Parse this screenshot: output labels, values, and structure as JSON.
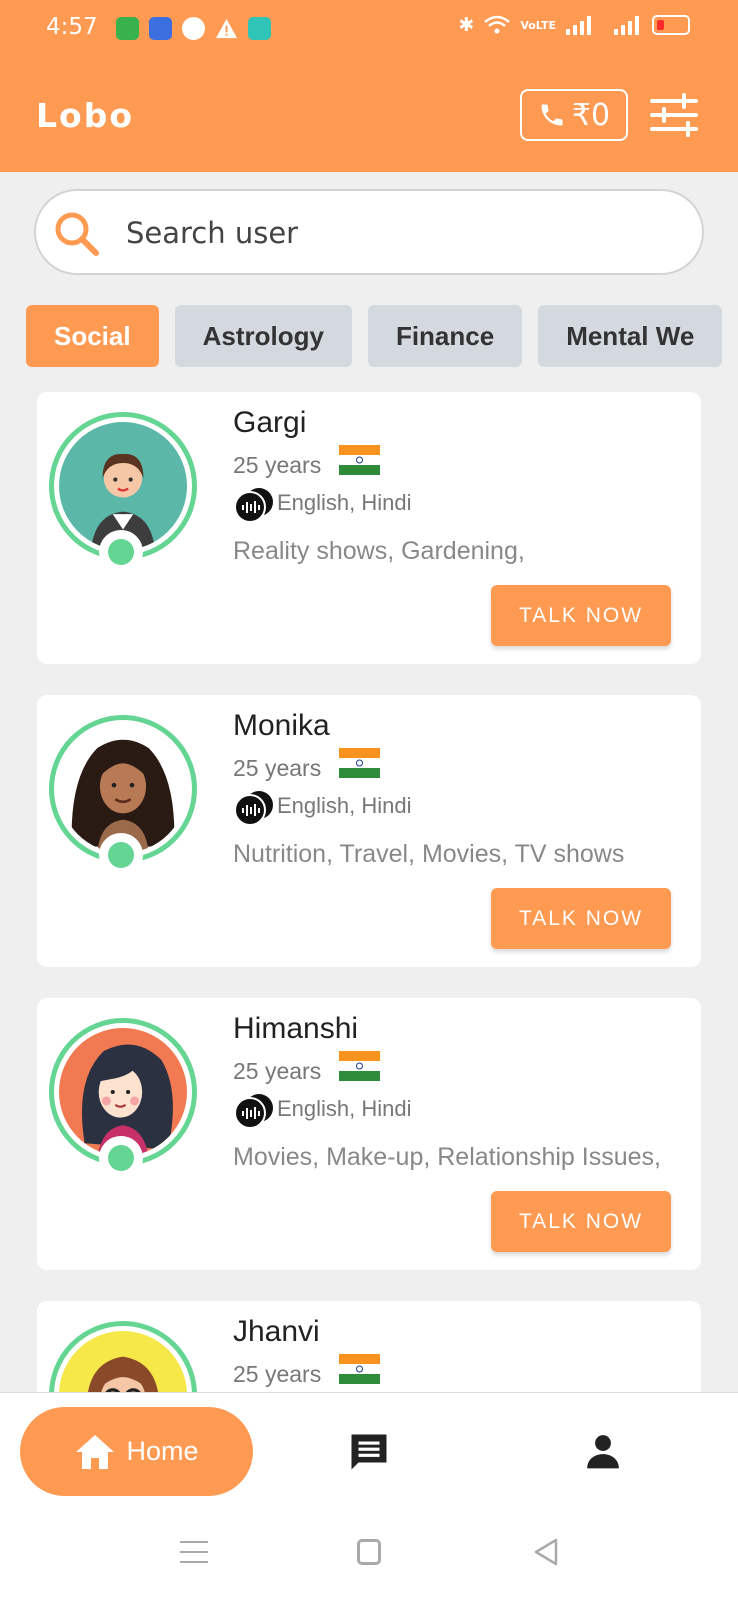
{
  "status_bar": {
    "time": "4:57",
    "right_text": "VoLTE"
  },
  "header": {
    "title": "Lobo",
    "wallet_amount": "₹0"
  },
  "search": {
    "placeholder": "Search user"
  },
  "categories": [
    "Social",
    "Astrology",
    "Finance",
    "Mental We"
  ],
  "users": [
    {
      "name": "Gargi",
      "age": "25 years",
      "languages": "English, Hindi",
      "interests": "Reality shows, Gardening,",
      "button": "TALK NOW"
    },
    {
      "name": "Monika",
      "age": "25 years",
      "languages": "English, Hindi",
      "interests": "Nutrition, Travel, Movies, TV shows",
      "button": "TALK NOW"
    },
    {
      "name": "Himanshi",
      "age": "25 years",
      "languages": "English, Hindi",
      "interests": "Movies, Make-up, Relationship Issues,",
      "button": "TALK NOW"
    },
    {
      "name": "Jhanvi",
      "age": "25 years",
      "languages": "",
      "interests": "",
      "button": ""
    }
  ],
  "bottom_nav": {
    "home_label": "Home"
  },
  "icons": {
    "search": "search-icon",
    "phone": "phone-icon",
    "filter": "sliders-icon",
    "language": "voice-chat-icon",
    "home": "home-icon",
    "chat": "chat-icon",
    "profile": "person-icon"
  },
  "colors": {
    "accent": "#ff9a52",
    "online": "#64d592",
    "chip_inactive": "#d3d9de"
  }
}
